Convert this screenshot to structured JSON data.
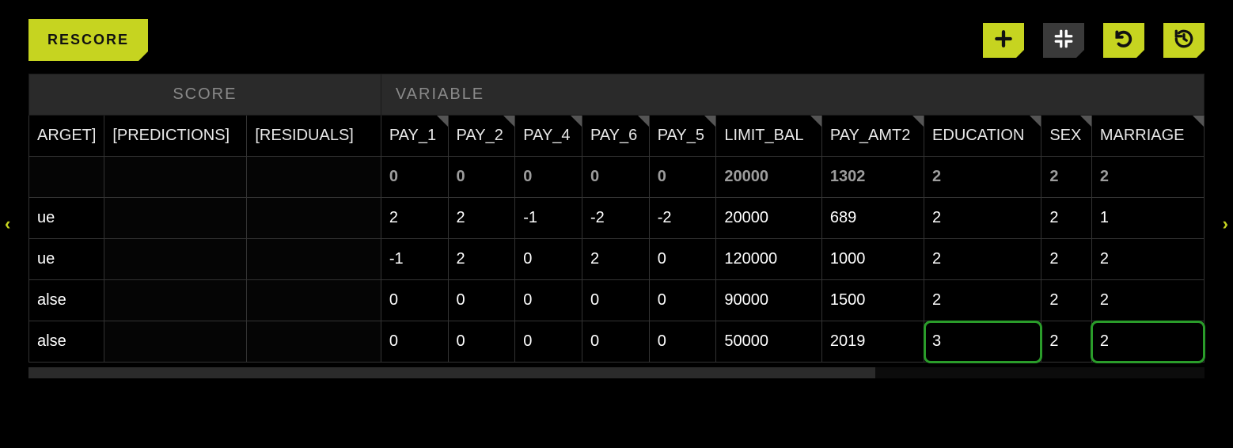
{
  "toolbar": {
    "rescore_label": "RESCORE",
    "icons": {
      "add": "add-icon",
      "collapse": "compress-icon",
      "undo": "undo-icon",
      "history": "history-icon"
    }
  },
  "nav": {
    "prev": "‹",
    "next": "›"
  },
  "group_headers": {
    "score": "SCORE",
    "variable": "VARIABLE"
  },
  "score_columns": [
    "ARGET]",
    "[PREDICTIONS]",
    "[RESIDUALS]"
  ],
  "variable_columns": [
    "PAY_1",
    "PAY_2",
    "PAY_4",
    "PAY_6",
    "PAY_5",
    "LIMIT_BAL",
    "PAY_AMT2",
    "EDUCATION",
    "SEX",
    "MARRIAGE"
  ],
  "rows": [
    {
      "target": "",
      "predictions": "",
      "residuals": "",
      "vars": [
        "0",
        "0",
        "0",
        "0",
        "0",
        "20000",
        "1302",
        "2",
        "2",
        "2"
      ],
      "hl": []
    },
    {
      "target": "ue",
      "predictions": "",
      "residuals": "",
      "vars": [
        "2",
        "2",
        "-1",
        "-2",
        "-2",
        "20000",
        "689",
        "2",
        "2",
        "1"
      ],
      "hl": []
    },
    {
      "target": "ue",
      "predictions": "",
      "residuals": "",
      "vars": [
        "-1",
        "2",
        "0",
        "2",
        "0",
        "120000",
        "1000",
        "2",
        "2",
        "2"
      ],
      "hl": []
    },
    {
      "target": "alse",
      "predictions": "",
      "residuals": "",
      "vars": [
        "0",
        "0",
        "0",
        "0",
        "0",
        "90000",
        "1500",
        "2",
        "2",
        "2"
      ],
      "hl": []
    },
    {
      "target": "alse",
      "predictions": "",
      "residuals": "",
      "vars": [
        "0",
        "0",
        "0",
        "0",
        "0",
        "50000",
        "2019",
        "3",
        "2",
        "2"
      ],
      "hl": [
        7,
        9
      ]
    }
  ]
}
